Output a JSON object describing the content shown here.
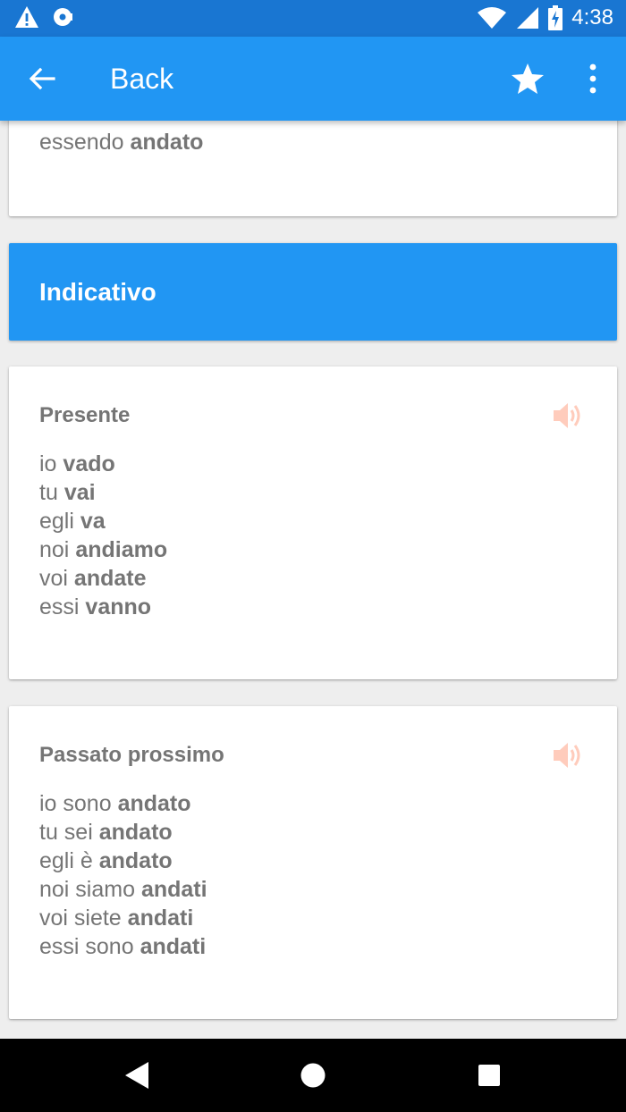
{
  "app_bar": {
    "title": "Back"
  },
  "status_bar": {
    "time": "4:38"
  },
  "top_card": {
    "prefix": "essendo",
    "form": "andato"
  },
  "section": {
    "title": "Indicativo"
  },
  "tenses": [
    {
      "title": "Presente",
      "lines": [
        {
          "pronoun": "io",
          "form": "vado"
        },
        {
          "pronoun": "tu",
          "form": "vai"
        },
        {
          "pronoun": "egli",
          "form": "va"
        },
        {
          "pronoun": "noi",
          "form": "andiamo"
        },
        {
          "pronoun": "voi",
          "form": "andate"
        },
        {
          "pronoun": "essi",
          "form": "vanno"
        }
      ]
    },
    {
      "title": "Passato prossimo",
      "lines": [
        {
          "pronoun": "io sono",
          "form": "andato"
        },
        {
          "pronoun": "tu sei",
          "form": "andato"
        },
        {
          "pronoun": "egli è",
          "form": "andato"
        },
        {
          "pronoun": "noi siamo",
          "form": "andati"
        },
        {
          "pronoun": "voi siete",
          "form": "andati"
        },
        {
          "pronoun": "essi sono",
          "form": "andati"
        }
      ]
    }
  ],
  "colors": {
    "status_bar": "#1976d2",
    "app_bar": "#2196f3",
    "section_header": "#2196f3",
    "text": "#757575",
    "speaker": "#ffccbc"
  },
  "icons": [
    "warning-icon",
    "sync-icon",
    "wifi-icon",
    "signal-icon",
    "battery-charging-icon",
    "back-arrow-icon",
    "star-icon",
    "more-vert-icon",
    "speaker-icon",
    "nav-back-icon",
    "nav-home-icon",
    "nav-recents-icon"
  ]
}
